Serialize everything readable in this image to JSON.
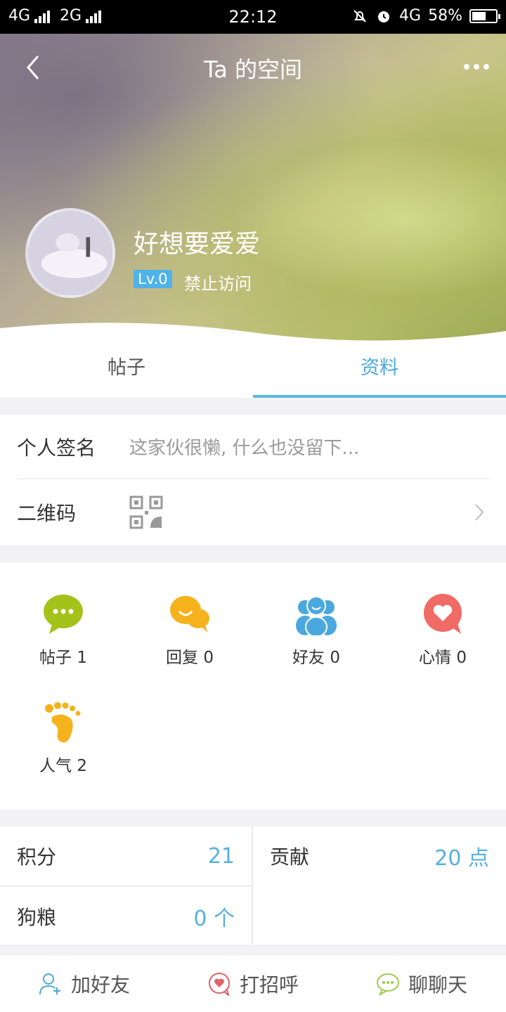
{
  "status_bar": {
    "network1": "4G",
    "network2": "2G",
    "time": "22:12",
    "network3": "4G",
    "battery": "58%",
    "battery_level": 0.58
  },
  "header": {
    "title": "Ta 的空间",
    "user_name": "好想要爱爱",
    "level": "Lv.0",
    "access_status": "禁止访问"
  },
  "tabs": [
    {
      "label": "帖子",
      "active": false
    },
    {
      "label": "资料",
      "active": true
    }
  ],
  "profile": {
    "signature_label": "个人签名",
    "signature_value": "这家伙很懒, 什么也没留下...",
    "qrcode_label": "二维码"
  },
  "stats": [
    {
      "label": "帖子 1",
      "icon": "chat-bubble-icon",
      "color": "#a4c21a"
    },
    {
      "label": "回复 0",
      "icon": "reply-bubbles-icon",
      "color": "#f5b21c"
    },
    {
      "label": "好友 0",
      "icon": "friends-icon",
      "color": "#4aa8de"
    },
    {
      "label": "心情 0",
      "icon": "heart-bubble-icon",
      "color": "#f06a66"
    },
    {
      "label": "人气 2",
      "icon": "footprint-icon",
      "color": "#f5b21c"
    }
  ],
  "scores": {
    "points_label": "积分",
    "points_value": "21",
    "contribution_label": "贡献",
    "contribution_value": "20 点",
    "dogfood_label": "狗粮",
    "dogfood_value": "0 个"
  },
  "actions": {
    "add_friend": "加好友",
    "greet": "打招呼",
    "chat": "聊聊天"
  },
  "colors": {
    "accent": "#4ba8da"
  }
}
